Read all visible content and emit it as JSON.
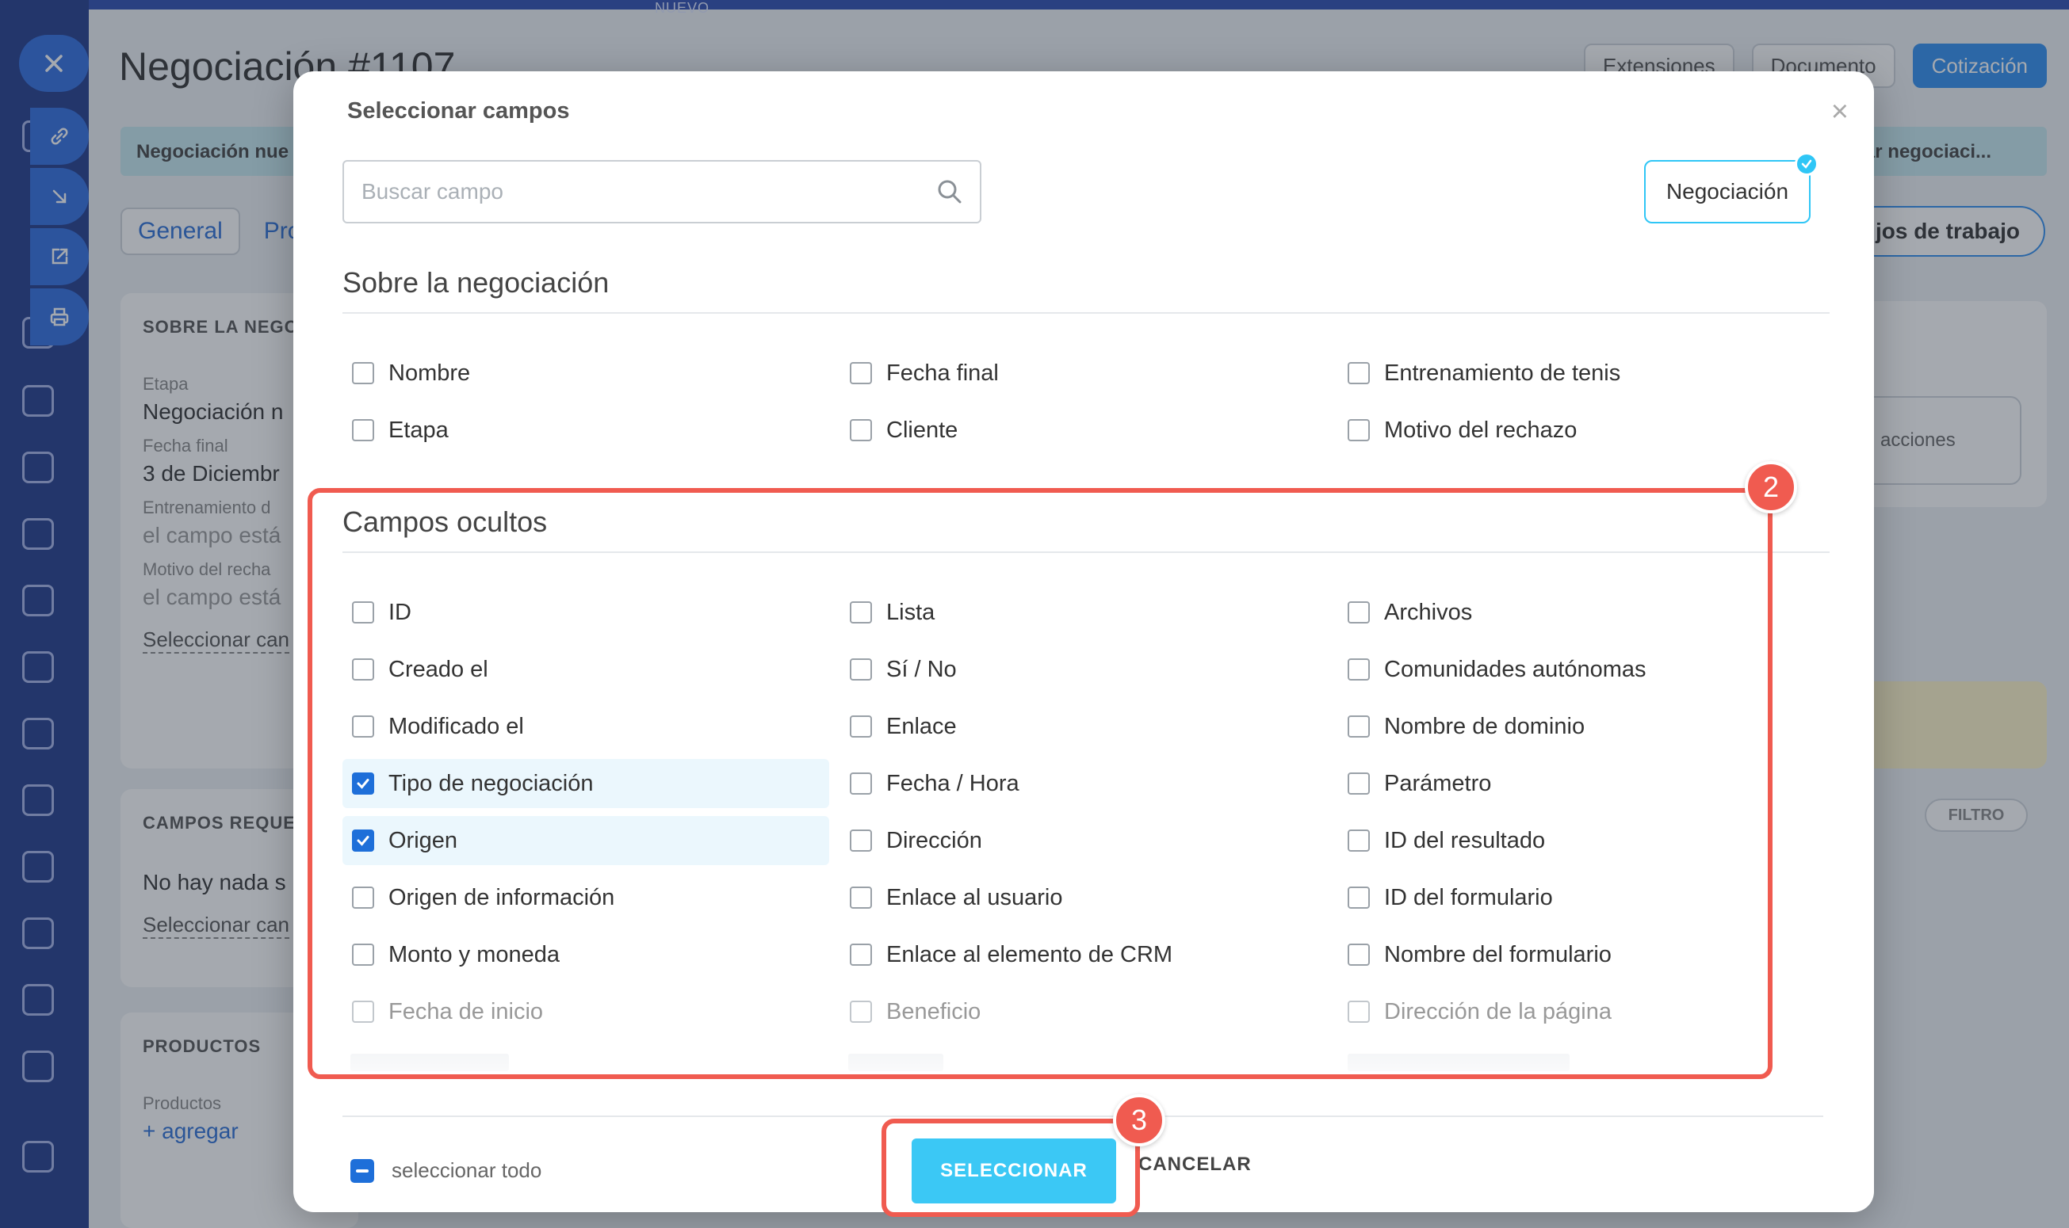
{
  "background": {
    "top_label": "NUEVO",
    "page_title": "Negociación #1107",
    "top_actions": [
      "Extensiones",
      "Documento",
      "Cotización"
    ],
    "stage_left": "Negociación nue",
    "stage_right": "rrar negociaci...",
    "tabs": [
      "General",
      "Pro"
    ],
    "workflow_button": "jos de trabajo",
    "card1": {
      "heading": "SOBRE LA NEGOC",
      "rows": [
        {
          "k": "Etapa",
          "v": "Negociación n"
        },
        {
          "k": "Fecha final",
          "v": "3 de Diciembr"
        },
        {
          "k": "Entrenamiento d",
          "v": "el campo está"
        },
        {
          "k": "Motivo del recha",
          "v": "el campo está"
        }
      ],
      "link": "Seleccionar can"
    },
    "card2": {
      "heading": "CAMPOS REQUER",
      "text": "No hay nada s",
      "link": "Seleccionar can"
    },
    "card3": {
      "heading": "PRODUCTOS",
      "k": "Productos",
      "add": "+ agregar"
    },
    "actions_button": "acciones",
    "filter_button": "FILTRO"
  },
  "modal": {
    "title": "Seleccionar campos",
    "close_icon": "close-icon",
    "search_placeholder": "Buscar campo",
    "entity_chip": "Negociación",
    "section_about": "Sobre la negociación",
    "about_fields": [
      [
        "Nombre",
        "Fecha final",
        "Entrenamiento de tenis"
      ],
      [
        "Etapa",
        "Cliente",
        "Motivo del rechazo"
      ]
    ],
    "section_hidden": "Campos ocultos",
    "hidden_fields": [
      [
        {
          "label": "ID",
          "checked": false
        },
        {
          "label": "Lista",
          "checked": false
        },
        {
          "label": "Archivos",
          "checked": false
        }
      ],
      [
        {
          "label": "Creado el",
          "checked": false
        },
        {
          "label": "Sí / No",
          "checked": false
        },
        {
          "label": "Comunidades autónomas",
          "checked": false
        }
      ],
      [
        {
          "label": "Modificado el",
          "checked": false
        },
        {
          "label": "Enlace",
          "checked": false
        },
        {
          "label": "Nombre de dominio",
          "checked": false
        }
      ],
      [
        {
          "label": "Tipo de negociación",
          "checked": true
        },
        {
          "label": "Fecha / Hora",
          "checked": false
        },
        {
          "label": "Parámetro",
          "checked": false
        }
      ],
      [
        {
          "label": "Origen",
          "checked": true
        },
        {
          "label": "Dirección",
          "checked": false
        },
        {
          "label": "ID del resultado",
          "checked": false
        }
      ],
      [
        {
          "label": "Origen de información",
          "checked": false
        },
        {
          "label": "Enlace al usuario",
          "checked": false
        },
        {
          "label": "ID del formulario",
          "checked": false
        }
      ],
      [
        {
          "label": "Monto y moneda",
          "checked": false
        },
        {
          "label": "Enlace al elemento de CRM",
          "checked": false
        },
        {
          "label": "Nombre del formulario",
          "checked": false
        }
      ],
      [
        {
          "label": "Fecha de inicio",
          "checked": false
        },
        {
          "label": "Beneficio",
          "checked": false
        },
        {
          "label": "Dirección de la página",
          "checked": false
        }
      ]
    ],
    "select_all": "seleccionar todo",
    "select_button": "SELECCIONAR",
    "cancel_button": "CANCELAR"
  },
  "annotations": {
    "badge_hidden": "2",
    "badge_select": "3",
    "color": "#f05b50"
  },
  "colors": {
    "accent": "#3bc8f5",
    "checkbox": "#1e6fd9",
    "chip_border": "#2fc6f6"
  }
}
